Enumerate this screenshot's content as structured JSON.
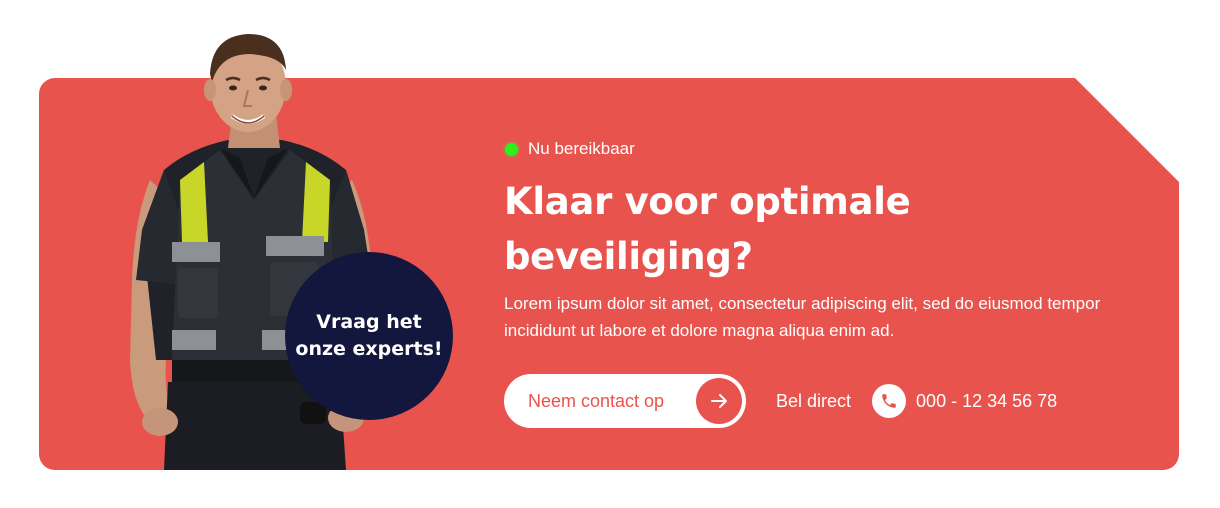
{
  "colors": {
    "banner": "#e8534d",
    "badge": "#13163d",
    "status_dot": "#2df01e",
    "text": "#ffffff"
  },
  "status": {
    "label": "Nu bereikbaar"
  },
  "headline": "Klaar voor optimale beveiliging?",
  "description": "Lorem ipsum dolor sit amet, consectetur adipiscing elit, sed do eiusmod tempor incididunt ut labore et dolore magna aliqua enim ad.",
  "badge": {
    "label": "Vraag het onze experts!"
  },
  "actions": {
    "contact_label": "Neem contact op",
    "contact_icon": "arrow-right-icon",
    "call_label": "Bel direct",
    "phone_icon": "phone-icon",
    "phone_number": "000 - 12 34 56 78"
  }
}
